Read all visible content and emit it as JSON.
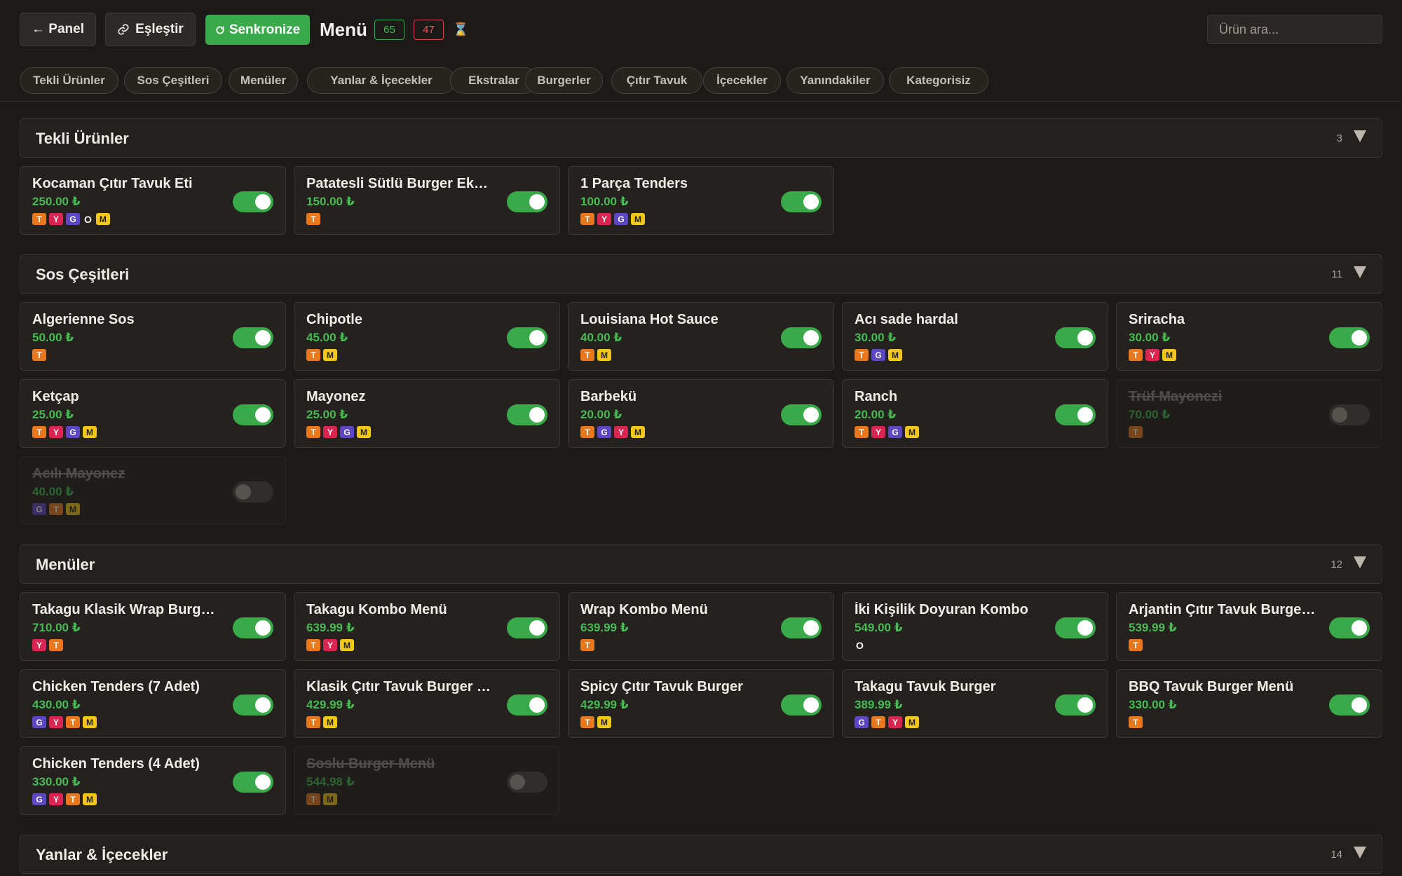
{
  "toolbar": {
    "back_label": "← Panel",
    "pair_label": "Eşleştir",
    "sync_label": "Senkronize",
    "title": "Menü",
    "count_active": "65",
    "count_inactive": "47",
    "hourglass": "⌛",
    "search_placeholder": "Ürün ara..."
  },
  "icons": {
    "pair": "link-icon",
    "sync": "refresh-icon",
    "hourglass": "hourglass-icon",
    "chevron": "chevron-down-icon"
  },
  "colors": {
    "accent_green": "#3aa94a",
    "danger_red": "#d9454b",
    "tag_T": "#e9771c",
    "tag_Y": "#d9254f",
    "tag_G": "#5c47c4",
    "tag_M": "#f2c719"
  },
  "tabs": [
    "Tekli Ürünler",
    "Sos Çeşitleri",
    "Menüler",
    "Yanlar & İçecekler",
    "Ekstralar",
    "Burgerler",
    "Çıtır Tavuk",
    "İçecekler",
    "Yanındakiler",
    "Kategorisiz"
  ],
  "sections": [
    {
      "name": "Tekli Ürünler",
      "count": "3",
      "items": [
        {
          "name": "Kocaman Çıtır Tavuk Eti",
          "price": "250.00 ₺",
          "tags": [
            "T",
            "Y",
            "G",
            "O",
            "M"
          ],
          "active": true
        },
        {
          "name": "Patatesli Sütlü Burger Ekmeği",
          "price": "150.00 ₺",
          "tags": [
            "T"
          ],
          "active": true
        },
        {
          "name": "1 Parça Tenders",
          "price": "100.00 ₺",
          "tags": [
            "T",
            "Y",
            "G",
            "M"
          ],
          "active": true
        }
      ]
    },
    {
      "name": "Sos Çeşitleri",
      "count": "11",
      "items": [
        {
          "name": "Algerienne Sos",
          "price": "50.00 ₺",
          "tags": [
            "T"
          ],
          "active": true
        },
        {
          "name": "Chipotle",
          "price": "45.00 ₺",
          "tags": [
            "T",
            "M"
          ],
          "active": true
        },
        {
          "name": "Louisiana Hot Sauce",
          "price": "40.00 ₺",
          "tags": [
            "T",
            "M"
          ],
          "active": true
        },
        {
          "name": "Acı sade hardal",
          "price": "30.00 ₺",
          "tags": [
            "T",
            "G",
            "M"
          ],
          "active": true
        },
        {
          "name": "Sriracha",
          "price": "30.00 ₺",
          "tags": [
            "T",
            "Y",
            "M"
          ],
          "active": true
        },
        {
          "name": "Ketçap",
          "price": "25.00 ₺",
          "tags": [
            "T",
            "Y",
            "G",
            "M"
          ],
          "active": true
        },
        {
          "name": "Mayonez",
          "price": "25.00 ₺",
          "tags": [
            "T",
            "Y",
            "G",
            "M"
          ],
          "active": true
        },
        {
          "name": "Barbekü",
          "price": "20.00 ₺",
          "tags": [
            "T",
            "G",
            "Y",
            "M"
          ],
          "active": true
        },
        {
          "name": "Ranch",
          "price": "20.00 ₺",
          "tags": [
            "T",
            "Y",
            "G",
            "M"
          ],
          "active": true
        },
        {
          "name": "Trüf Mayonezi",
          "price": "70.00 ₺",
          "tags": [
            "T"
          ],
          "active": false
        },
        {
          "name": "Acılı Mayonez",
          "price": "40.00 ₺",
          "tags": [
            "G",
            "T",
            "M"
          ],
          "active": false
        }
      ]
    },
    {
      "name": "Menüler",
      "count": "12",
      "items": [
        {
          "name": "Takagu Klasik Wrap Burger Menü",
          "price": "710.00 ₺",
          "tags": [
            "Y",
            "T"
          ],
          "active": true
        },
        {
          "name": "Takagu Kombo Menü",
          "price": "639.99 ₺",
          "tags": [
            "T",
            "Y",
            "M"
          ],
          "active": true
        },
        {
          "name": "Wrap Kombo Menü",
          "price": "639.99 ₺",
          "tags": [
            "T"
          ],
          "active": true
        },
        {
          "name": "İki Kişilik Doyuran Kombo",
          "price": "549.00 ₺",
          "tags": [
            "O"
          ],
          "active": true
        },
        {
          "name": "Arjantin Çıtır Tavuk Burger Menü",
          "price": "539.99 ₺",
          "tags": [
            "T"
          ],
          "active": true
        },
        {
          "name": "Chicken Tenders (7 Adet)",
          "price": "430.00 ₺",
          "tags": [
            "G",
            "Y",
            "T",
            "M"
          ],
          "active": true
        },
        {
          "name": "Klasik Çıtır Tavuk Burger Menü",
          "price": "429.99 ₺",
          "tags": [
            "T",
            "M"
          ],
          "active": true
        },
        {
          "name": "Spicy Çıtır Tavuk Burger",
          "price": "429.99 ₺",
          "tags": [
            "T",
            "M"
          ],
          "active": true
        },
        {
          "name": "Takagu Tavuk Burger",
          "price": "389.99 ₺",
          "tags": [
            "G",
            "T",
            "Y",
            "M"
          ],
          "active": true
        },
        {
          "name": "BBQ Tavuk Burger Menü",
          "price": "330.00 ₺",
          "tags": [
            "T"
          ],
          "active": true
        },
        {
          "name": "Chicken Tenders (4 Adet)",
          "price": "330.00 ₺",
          "tags": [
            "G",
            "Y",
            "T",
            "M"
          ],
          "active": true
        },
        {
          "name": "Soslu Burger Menü",
          "price": "544.98 ₺",
          "tags": [
            "T",
            "M"
          ],
          "active": false
        }
      ]
    },
    {
      "name": "Yanlar & İçecekler",
      "count": "14",
      "items": []
    }
  ]
}
